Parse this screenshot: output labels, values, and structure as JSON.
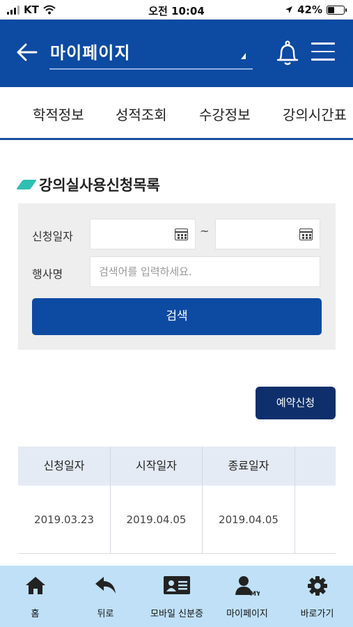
{
  "status_bar": {
    "carrier": "KT",
    "time": "오전 10:04",
    "battery": "42%",
    "battery_level": 0.42
  },
  "header": {
    "title": "마이페이지",
    "back_icon": "arrow-left-icon",
    "bell_icon": "bell-icon",
    "menu_icon": "hamburger-menu-icon"
  },
  "tabs": [
    "학적정보",
    "성적조회",
    "수강정보",
    "강의시간표"
  ],
  "section": {
    "title": "강의실사용신청목록"
  },
  "search": {
    "date_label": "신청일자",
    "date_separator": "~",
    "name_label": "행사명",
    "name_placeholder": "검색어를 입력하세요.",
    "button": "검색"
  },
  "reserve_button": "예약신청",
  "table": {
    "headers": [
      "신청일자",
      "시작일자",
      "종료일자",
      ""
    ],
    "rows": [
      [
        "2019.03.23",
        "2019.04.05",
        "2019.04.05",
        ""
      ]
    ]
  },
  "bottom_nav": [
    {
      "label": "홈",
      "icon": "home-icon"
    },
    {
      "label": "뒤로",
      "icon": "back-arrow-icon"
    },
    {
      "label": "모바일 신분증",
      "icon": "id-card-icon"
    },
    {
      "label": "마이페이지",
      "icon": "my-user-icon"
    },
    {
      "label": "바로가기",
      "icon": "gear-icon"
    }
  ],
  "colors": {
    "header": "#0d4aa2",
    "button": "#0d4aa2",
    "reserve_button": "#0e2f6b",
    "accent_mark": "#2fbfb0",
    "bottom_nav": "#bfe0f7"
  }
}
